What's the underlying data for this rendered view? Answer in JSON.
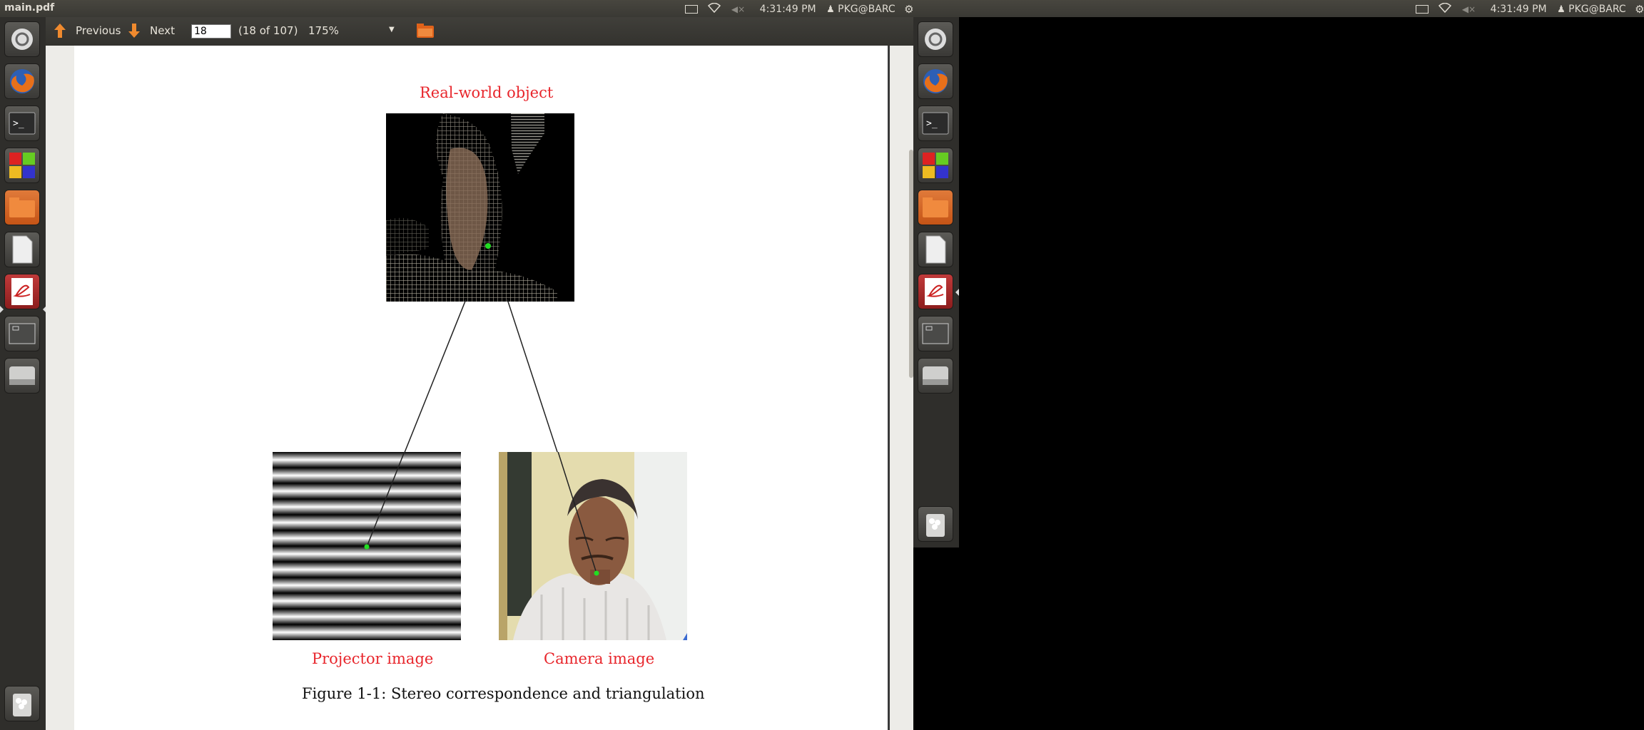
{
  "window": {
    "title": "main.pdf"
  },
  "indicators": {
    "time": "4:31:49 PM",
    "user": "PKG@BARC"
  },
  "toolbar": {
    "previous_label": "Previous",
    "next_label": "Next",
    "page_value": "18",
    "page_count": "(18 of 107)",
    "zoom": "175%"
  },
  "launcher": {
    "items": [
      "dash-icon",
      "firefox-icon",
      "terminal-icon",
      "workspaces-icon",
      "files-icon",
      "document-icon",
      "evince-icon",
      "window-icon",
      "drive-icon"
    ],
    "trash": "trash-icon"
  },
  "figure": {
    "top_label": "Real-world object",
    "left_label": "Projector image",
    "right_label": "Camera image",
    "caption": "Figure 1-1: Stereo correspondence and triangulation"
  },
  "colors": {
    "label_red": "#e8262c",
    "marker_green": "#22dd22",
    "accent_orange": "#e8701a"
  }
}
